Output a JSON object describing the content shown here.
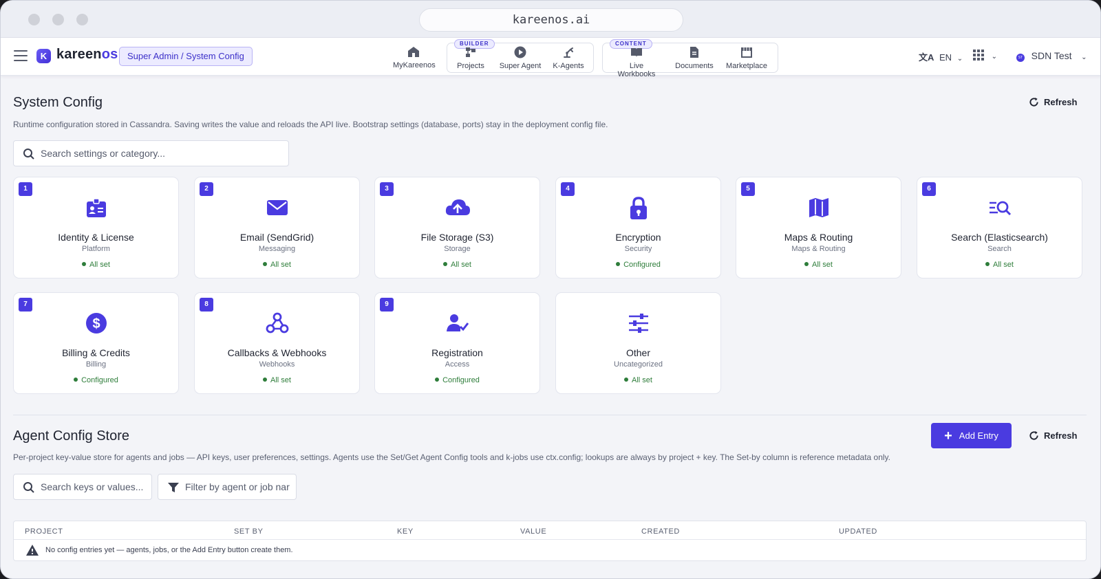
{
  "browser": {
    "url": "kareenos.ai"
  },
  "header": {
    "brand": {
      "mark": "K",
      "name_a": "kareen",
      "name_b": "os"
    },
    "role_chip": "Super Admin / System Config",
    "nav": {
      "mykareenos": "MyKareenos",
      "builder_tag": "BUILDER",
      "projects": "Projects",
      "super_agent": "Super Agent",
      "k_agents": "K-Agents",
      "content_tag": "CONTENT",
      "live_workbooks": "Live Workbooks",
      "documents": "Documents",
      "marketplace": "Marketplace"
    },
    "language": "EN",
    "org_badge": "ST",
    "org": "SDN Test"
  },
  "system_config": {
    "title": "System Config",
    "description": "Runtime configuration stored in Cassandra. Saving writes the value and reloads the API live. Bootstrap settings (database, ports) stay in the deployment config file.",
    "refresh_label": "Refresh",
    "search_placeholder": "Search settings or category...",
    "cards": [
      {
        "num": "1",
        "icon": "badge-icon",
        "title": "Identity & License",
        "category": "Platform",
        "status": "All set"
      },
      {
        "num": "2",
        "icon": "envelope-icon",
        "title": "Email (SendGrid)",
        "category": "Messaging",
        "status": "All set"
      },
      {
        "num": "3",
        "icon": "cloud-upload-icon",
        "title": "File Storage (S3)",
        "category": "Storage",
        "status": "All set"
      },
      {
        "num": "4",
        "icon": "lock-icon",
        "title": "Encryption",
        "category": "Security",
        "status": "Configured"
      },
      {
        "num": "5",
        "icon": "map-icon",
        "title": "Maps & Routing",
        "category": "Maps & Routing",
        "status": "All set"
      },
      {
        "num": "6",
        "icon": "search-list-icon",
        "title": "Search (Elasticsearch)",
        "category": "Search",
        "status": "All set"
      },
      {
        "num": "7",
        "icon": "dollar-icon",
        "title": "Billing & Credits",
        "category": "Billing",
        "status": "Configured"
      },
      {
        "num": "8",
        "icon": "webhook-icon",
        "title": "Callbacks & Webhooks",
        "category": "Webhooks",
        "status": "All set"
      },
      {
        "num": "9",
        "icon": "user-check-icon",
        "title": "Registration",
        "category": "Access",
        "status": "Configured"
      },
      {
        "num": "",
        "icon": "sliders-icon",
        "title": "Other",
        "category": "Uncategorized",
        "status": "All set"
      }
    ]
  },
  "agent_config": {
    "title": "Agent Config Store",
    "description": "Per-project key-value store for agents and jobs — API keys, user preferences, settings. Agents use the Set/Get Agent Config tools and k-jobs use ctx.config; lookups are always by project + key. The Set-by column is reference metadata only.",
    "add_label": "Add Entry",
    "refresh_label": "Refresh",
    "search_placeholder": "Search keys or values...",
    "filter_placeholder": "Filter by agent or job nar",
    "columns": [
      "PROJECT",
      "SET BY",
      "KEY",
      "VALUE",
      "CREATED",
      "UPDATED"
    ],
    "empty_message": "No config entries yet — agents, jobs, or the Add Entry button create them."
  },
  "colors": {
    "accent": "#4a3be0",
    "status_ok": "#2e7d3a"
  }
}
